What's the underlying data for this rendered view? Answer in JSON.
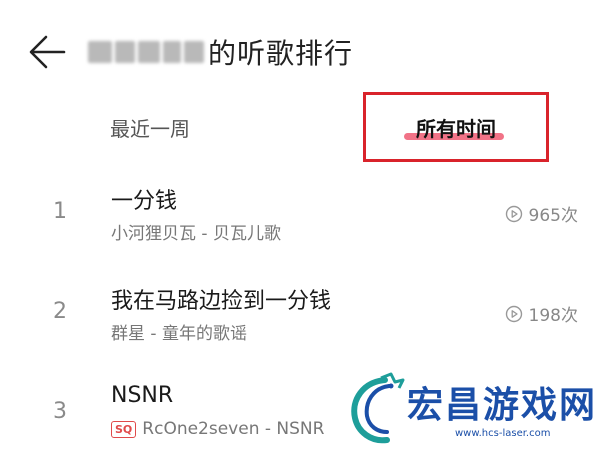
{
  "header": {
    "title_suffix": "的听歌排行"
  },
  "tabs": [
    {
      "label": "最近一周",
      "selected": false
    },
    {
      "label": "所有时间",
      "selected": true
    }
  ],
  "songs": [
    {
      "rank": "1",
      "title": "一分钱",
      "artist": "小河狸贝瓦 - 贝瓦儿歌",
      "plays": "965次"
    },
    {
      "rank": "2",
      "title": "我在马路边捡到一分钱",
      "artist": "群星 - 童年的歌谣",
      "plays": "198次"
    },
    {
      "rank": "3",
      "title": "NSNR",
      "artist": "RcOne2seven - NSNR",
      "badge": "SQ"
    }
  ],
  "watermark": {
    "text": "宏昌游戏网",
    "url": "www.hcs-laser.com"
  },
  "colors": {
    "highlight_border": "#d9232b",
    "tab_underline": "#ef5a72",
    "watermark_blue": "#1b4fa8",
    "sq_badge": "#e04a4a"
  }
}
